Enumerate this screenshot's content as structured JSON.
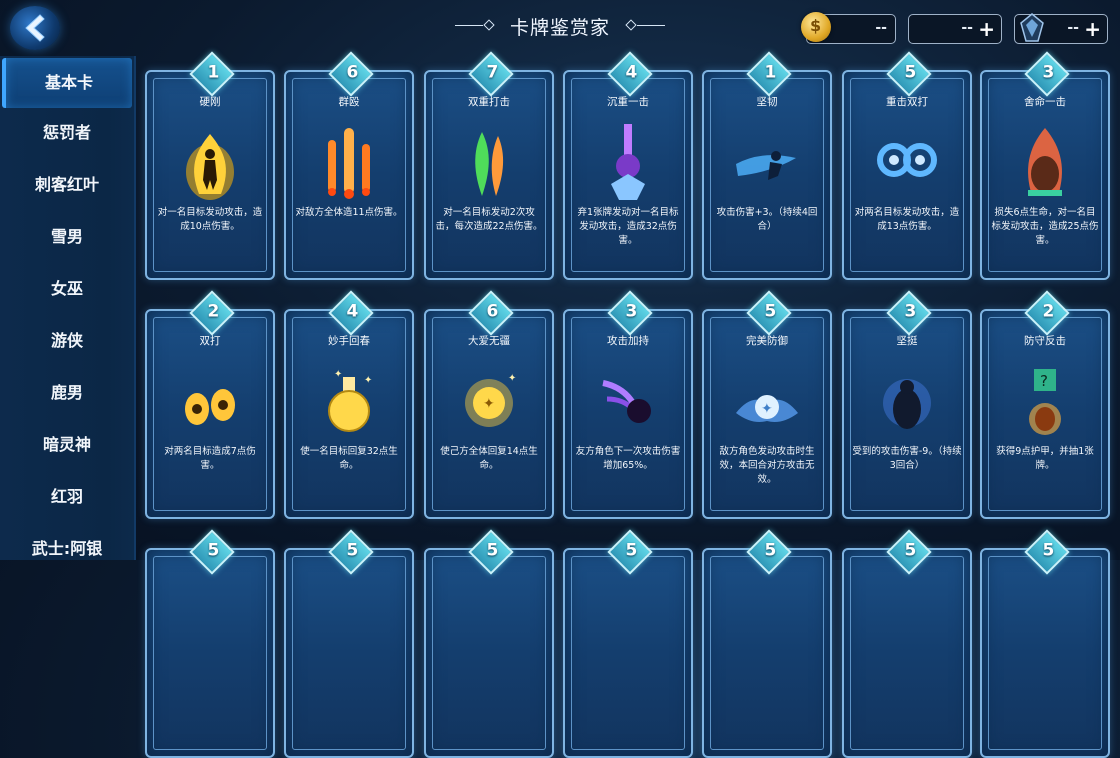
{
  "header": {
    "title": "卡牌鉴赏家",
    "resources": [
      {
        "id": "coin",
        "value": "--",
        "has_plus": false
      },
      {
        "id": "resource2",
        "value": "--",
        "has_plus": true
      },
      {
        "id": "crystal",
        "value": "--",
        "has_plus": true
      }
    ],
    "plus_label": "+",
    "coin_glyph": "$"
  },
  "sidebar": {
    "items": [
      {
        "label": "基本卡",
        "active": true
      },
      {
        "label": "惩罚者"
      },
      {
        "label": "刺客红叶"
      },
      {
        "label": "雪男"
      },
      {
        "label": "女巫"
      },
      {
        "label": "游侠"
      },
      {
        "label": "鹿男"
      },
      {
        "label": "暗灵神"
      },
      {
        "label": "红羽"
      },
      {
        "label": "武士:阿银"
      }
    ]
  },
  "cards": [
    {
      "cost": "1",
      "name": "硬刚",
      "desc": "对一名目标发动攻击，造成10点伤害。",
      "icon": "flame-figure-icon",
      "color": "#ffd23a"
    },
    {
      "cost": "6",
      "name": "群殴",
      "desc": "对敌方全体造11点伤害。",
      "icon": "fire-pillars-icon",
      "color": "#ff8a2a"
    },
    {
      "cost": "7",
      "name": "双重打击",
      "desc": "对一名目标发动2次攻击，每次造成22点伤害。",
      "icon": "twin-flame-icon",
      "color": "#5fe06a"
    },
    {
      "cost": "4",
      "name": "沉重一击",
      "desc": "弃1张牌发动对一名目标发动攻击，造成32点伤害。",
      "icon": "purple-beam-icon",
      "color": "#b06cff"
    },
    {
      "cost": "1",
      "name": "坚韧",
      "desc": "攻击伤害+3。（持续4回合）",
      "icon": "dash-runner-icon",
      "color": "#4fb4ff"
    },
    {
      "cost": "5",
      "name": "重击双打",
      "desc": "对两名目标发动攻击，造成13点伤害。",
      "icon": "twin-swirl-icon",
      "color": "#4fa8ff"
    },
    {
      "cost": "3",
      "name": "舍命一击",
      "desc": "损失6点生命，对一名目标发动攻击，造成25点伤害。",
      "icon": "fire-brute-icon",
      "color": "#ff6a3a"
    },
    {
      "cost": "2",
      "name": "双打",
      "desc": "对两名目标造成7点伤害。",
      "icon": "twin-fist-icon",
      "color": "#ffc63a"
    },
    {
      "cost": "4",
      "name": "妙手回春",
      "desc": "使一名目标回复32点生命。",
      "icon": "potion-icon",
      "color": "#ffd84a"
    },
    {
      "cost": "6",
      "name": "大爱无疆",
      "desc": "使己方全体回复14点生命。",
      "icon": "golden-orb-icon",
      "color": "#ffcf3a"
    },
    {
      "cost": "3",
      "name": "攻击加持",
      "desc": "友方角色下一次攻击伤害增加65%。",
      "icon": "purple-fist-icon",
      "color": "#a56cff"
    },
    {
      "cost": "5",
      "name": "完美防御",
      "desc": "敌方角色发动攻击时生效，本回合对方攻击无效。",
      "icon": "shield-star-icon",
      "color": "#7ec8ff"
    },
    {
      "cost": "3",
      "name": "坚挺",
      "desc": "受到的攻击伤害-9。（持续3回合）",
      "icon": "dark-guard-icon",
      "color": "#6fa6ff"
    },
    {
      "cost": "2",
      "name": "防守反击",
      "desc": "获得9点护甲，并抽1张牌。",
      "icon": "mystery-brute-icon",
      "color": "#ffb23a"
    },
    {
      "cost": "5"
    },
    {
      "cost": "5"
    },
    {
      "cost": "5"
    },
    {
      "cost": "5"
    },
    {
      "cost": "5"
    },
    {
      "cost": "5"
    },
    {
      "cost": "5"
    }
  ]
}
